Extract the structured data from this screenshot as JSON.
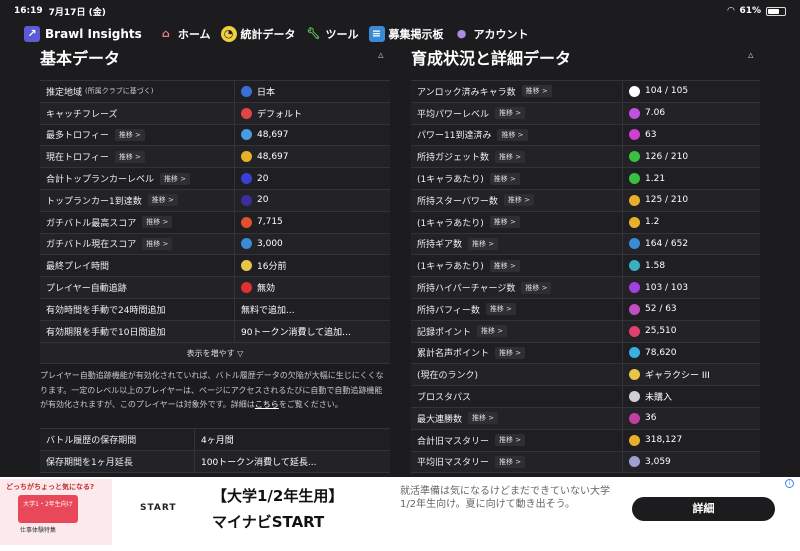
{
  "status": {
    "time": "16:19",
    "date": "7月17日 (金)",
    "battery": "61%"
  },
  "nav": {
    "brand": "Brawl Insights",
    "items": [
      "ホーム",
      "統計データ",
      "ツール",
      "募集掲示板",
      "アカウント"
    ]
  },
  "left": {
    "title": "基本データ",
    "rows": [
      {
        "label": "推定地域",
        "sub": "(所属クラブに基づく)",
        "tag": "",
        "value": "日本",
        "icon": "globe-icon",
        "color": "#3b6fd6"
      },
      {
        "label": "キャッチフレーズ",
        "sub": "",
        "tag": "",
        "value": "デフォルト",
        "icon": "badge-icon",
        "color": "#e04545"
      },
      {
        "label": "最多トロフィー",
        "sub": "",
        "tag": "推移 >",
        "value": "48,697",
        "icon": "trophy-stack-icon",
        "color": "#4a9ce0"
      },
      {
        "label": "現在トロフィー",
        "sub": "",
        "tag": "推移 >",
        "value": "48,697",
        "icon": "trophy-icon",
        "color": "#e8b02a"
      },
      {
        "label": "合計トップランカーレベル",
        "sub": "",
        "tag": "推移 >",
        "value": "20",
        "icon": "rank-icon",
        "color": "#3b3fd6"
      },
      {
        "label": "トップランカー1到達数",
        "sub": "",
        "tag": "推移 >",
        "value": "20",
        "icon": "rank-badge-icon",
        "color": "#3a2f9a"
      },
      {
        "label": "ガチバトル最高スコア",
        "sub": "",
        "tag": "推移 >",
        "value": "7,715",
        "icon": "score-icon",
        "color": "#e05030"
      },
      {
        "label": "ガチバトル現在スコア",
        "sub": "",
        "tag": "推移 >",
        "value": "3,000",
        "icon": "score-current-icon",
        "color": "#3a8ad6"
      },
      {
        "label": "最終プレイ時間",
        "sub": "",
        "tag": "",
        "value": "16分前",
        "icon": "clock-icon",
        "color": "#e8c44a"
      },
      {
        "label": "プレイヤー自動追跡",
        "sub": "",
        "tag": "",
        "value": "無効",
        "icon": "cross-icon",
        "color": "#e03030"
      },
      {
        "label": "有効時間を手動で24時間追加",
        "sub": "",
        "tag": "",
        "value": "無料で追加...",
        "icon": "",
        "color": ""
      },
      {
        "label": "有効期限を手動で10日間追加",
        "sub": "",
        "tag": "",
        "value": "90トークン消費して追加...",
        "icon": "",
        "color": ""
      }
    ],
    "show_more": "表示を増やす ▽",
    "note_pre": "プレイヤー自動追跡機能が有効化されていれば、バトル履歴データの欠陥が大幅に生じにくくなります。一定のレベル以上のプレイヤーは、ページにアクセスされるたびに自動で自動追跡機能が有効化されますが、このプレイヤーは対象外です。詳細は",
    "note_link": "こちら",
    "note_post": "をご覧ください。",
    "rows2": [
      {
        "label": "バトル履歴の保存期間",
        "value": "4ヶ月間"
      },
      {
        "label": "保存期間を1ヶ月延長",
        "value": "100トークン消費して延長..."
      }
    ]
  },
  "right": {
    "title": "育成状況と詳細データ",
    "rows": [
      {
        "label": "アンロック済みキャラ数",
        "tag": "推移 >",
        "value": "104 / 105",
        "icon": "brawler-icon",
        "color": "#ffffff"
      },
      {
        "label": "平均パワーレベル",
        "tag": "推移 >",
        "value": "7.06",
        "icon": "power-icon",
        "color": "#c050e0"
      },
      {
        "label": "パワー11到達済み",
        "tag": "推移 >",
        "value": "63",
        "icon": "power11-icon",
        "color": "#d040d0"
      },
      {
        "label": "所持ガジェット数",
        "tag": "推移 >",
        "value": "126 / 210",
        "icon": "gadget-icon",
        "color": "#3ac040"
      },
      {
        "label": "(1キャラあたり)",
        "tag": "推移 >",
        "value": "1.21",
        "icon": "gadget-per-icon",
        "color": "#3ac040"
      },
      {
        "label": "所持スターパワー数",
        "tag": "推移 >",
        "value": "125 / 210",
        "icon": "starpower-icon",
        "color": "#e8b02a"
      },
      {
        "label": "(1キャラあたり)",
        "tag": "推移 >",
        "value": "1.2",
        "icon": "starpower-per-icon",
        "color": "#e8b02a"
      },
      {
        "label": "所持ギア数",
        "tag": "推移 >",
        "value": "164 / 652",
        "icon": "gear-icon",
        "color": "#3a8ad6"
      },
      {
        "label": "(1キャラあたり)",
        "tag": "推移 >",
        "value": "1.58",
        "icon": "gear-per-icon",
        "color": "#3ab0c0"
      },
      {
        "label": "所持ハイパーチャージ数",
        "tag": "推移 >",
        "value": "103 / 103",
        "icon": "hypercharge-icon",
        "color": "#a040e0"
      },
      {
        "label": "所持バフィー数",
        "tag": "推移 >",
        "value": "52 / 63",
        "icon": "buffy-icon",
        "color": "#c050c0"
      },
      {
        "label": "記録ポイント",
        "tag": "推移 >",
        "value": "25,510",
        "icon": "record-icon",
        "color": "#e04070"
      },
      {
        "label": "累計名声ポイント",
        "tag": "推移 >",
        "value": "78,620",
        "icon": "fame-icon",
        "color": "#3ab0e0"
      },
      {
        "label": "(現在のランク)",
        "tag": "",
        "value": "ギャラクシー III",
        "icon": "galaxy-icon",
        "color": "#e8c44a"
      },
      {
        "label": "ブロスタパス",
        "tag": "",
        "value": "未購入",
        "icon": "pass-icon",
        "color": "#d0d0d0"
      },
      {
        "label": "最大連勝数",
        "tag": "推移 >",
        "value": "36",
        "icon": "streak-icon",
        "color": "#c040a0"
      },
      {
        "label": "合計旧マスタリー",
        "tag": "推移 >",
        "value": "318,127",
        "icon": "mastery-icon",
        "color": "#e8b02a"
      },
      {
        "label": "平均旧マスタリー",
        "tag": "推移 >",
        "value": "3,059",
        "icon": "mastery-avg-icon",
        "color": "#a0a0d0"
      }
    ]
  },
  "ad": {
    "thumb_top": "どっちがちょっと気になる?",
    "thumb_mid": "大学1・2年生向け",
    "thumb_bottom": "仕事体験特集",
    "logo": "START",
    "headline1": "【大学1/2年生用】",
    "headline2": "マイナビSTART",
    "desc": "就活準備は気になるけどまだできていない大学1/2年生向け。夏に向けて動き出そう。",
    "button": "詳細"
  }
}
